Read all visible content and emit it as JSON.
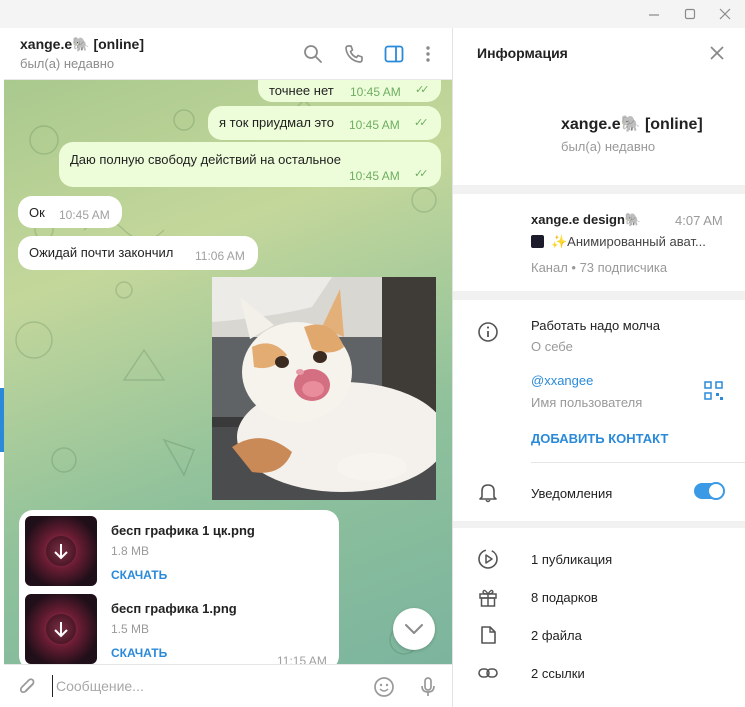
{
  "window": {
    "minimize_icon": "minimize-icon",
    "maximize_icon": "maximize-icon",
    "close_icon": "close-icon"
  },
  "chat": {
    "header": {
      "title": "xange.e🐘 [online]",
      "status": "был(а) недавно",
      "icons": [
        "search-icon",
        "phone-icon",
        "sidebar-toggle-icon",
        "more-vertical-icon"
      ]
    },
    "messages": [
      {
        "direction": "out",
        "text": "точнее нет",
        "time": "10:45 AM",
        "read": true
      },
      {
        "direction": "out",
        "text": "я ток приудмал это",
        "time": "10:45 AM",
        "read": true
      },
      {
        "direction": "out",
        "text": "Даю полную свободу действий на остальное",
        "time": "10:45 AM",
        "read": true
      },
      {
        "direction": "in",
        "text": "Ок",
        "time": "10:45 AM"
      },
      {
        "direction": "in",
        "text": "Ожидай почти закончил",
        "time": "11:06 AM"
      }
    ],
    "photo": {
      "subject": "cat-photo"
    },
    "files": [
      {
        "name": "бесп графика 1 цк.png",
        "size": "1.8 MB",
        "action": "СКАЧАТЬ"
      },
      {
        "name": "бесп графика 1.png",
        "size": "1.5 MB",
        "action": "СКАЧАТЬ"
      }
    ],
    "files_time": "11:15 AM",
    "composer": {
      "placeholder": "Сообщение...",
      "icons": [
        "attach-icon",
        "emoji-icon",
        "microphone-icon"
      ]
    }
  },
  "info_panel": {
    "title": "Информация",
    "profile": {
      "name": "xange.e🐘 [online]",
      "status": "был(а) недавно"
    },
    "channel": {
      "name": "xange.e design🐘",
      "time": "4:07 AM",
      "last_post": "✨Анимированный ават...",
      "meta": "Канал • 73 подписчика"
    },
    "about": {
      "text": "Работать надо молча",
      "label": "О себе"
    },
    "username": {
      "value": "@xxangee",
      "label": "Имя пользователя"
    },
    "add_contact": "ДОБАВИТЬ КОНТАКТ",
    "notifications": {
      "label": "Уведомления",
      "enabled": true
    },
    "stats": [
      {
        "icon": "play-circle-icon",
        "label": "1 публикация"
      },
      {
        "icon": "gift-icon",
        "label": "8 подарков"
      },
      {
        "icon": "file-icon",
        "label": "2 файла"
      },
      {
        "icon": "link-icon",
        "label": "2 ссылки"
      }
    ]
  },
  "colors": {
    "accent": "#2a8ad9",
    "outgoing_bubble": "#eefdd9",
    "read_check": "#6fae62"
  }
}
